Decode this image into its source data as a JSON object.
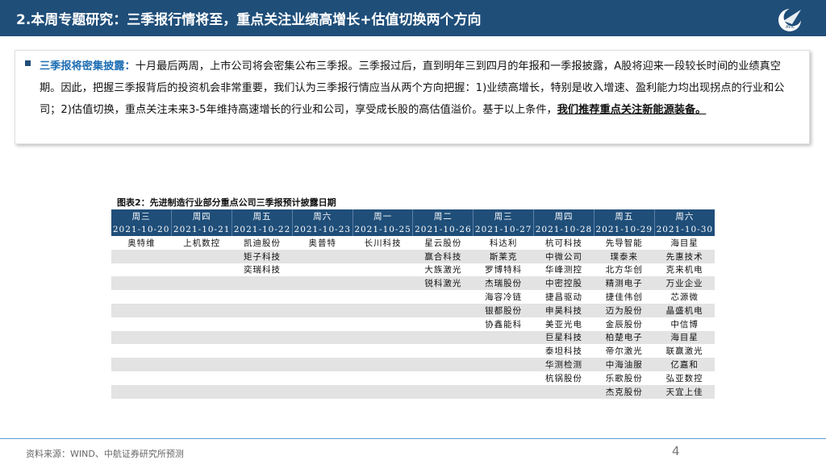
{
  "header": {
    "title": "2.本周专题研究：三季报行情将至，重点关注业绩高增长+估值切换两个方向",
    "logo_text": "AVIC"
  },
  "summary": {
    "lead": "三季报将密集披露：",
    "body": "十月最后两周，上市公司将会密集公布三季报。三季报过后，直到明年三到四月的年报和一季报披露，A股将迎来一段较长时间的业绩真空期。因此，把握三季报背后的投资机会非常重要，我们认为三季报行情应当从两个方向把握：1)业绩高增长，特别是收入增速、盈利能力均出现拐点的行业和公司；2)估值切换，重点关注未来3-5年维持高速增长的行业和公司，享受成长股的高估值溢价。基于以上条件，",
    "conclusion": "我们推荐重点关注新能源装备。"
  },
  "table": {
    "caption": "图表2：先进制造行业部分重点公司三季报预计披露日期",
    "columns": [
      {
        "day": "周三",
        "date": "2021-10-20",
        "companies": [
          "奥特维"
        ]
      },
      {
        "day": "周四",
        "date": "2021-10-21",
        "companies": [
          "上机数控"
        ]
      },
      {
        "day": "周五",
        "date": "2021-10-22",
        "companies": [
          "凯迪股份",
          "矩子科技",
          "奕瑞科技"
        ]
      },
      {
        "day": "周六",
        "date": "2021-10-23",
        "companies": [
          "奥普特"
        ]
      },
      {
        "day": "周一",
        "date": "2021-10-25",
        "companies": [
          "长川科技"
        ]
      },
      {
        "day": "周二",
        "date": "2021-10-26",
        "companies": [
          "星云股份",
          "赢合科技",
          "大族激光",
          "锐科激光"
        ]
      },
      {
        "day": "周三",
        "date": "2021-10-27",
        "companies": [
          "科达利",
          "斯莱克",
          "罗博特科",
          "杰瑞股份",
          "海容冷链",
          "银都股份",
          "协鑫能科"
        ]
      },
      {
        "day": "周四",
        "date": "2021-10-28",
        "companies": [
          "杭可科技",
          "中微公司",
          "华峰测控",
          "中密控股",
          "捷昌驱动",
          "申昊科技",
          "美亚光电",
          "巨星科技",
          "泰坦科技",
          "华测检测",
          "杭锅股份"
        ]
      },
      {
        "day": "周五",
        "date": "2021-10-29",
        "companies": [
          "先导智能",
          "璞泰来",
          "北方华创",
          "精测电子",
          "捷佳伟创",
          "迈为股份",
          "金辰股份",
          "柏楚电子",
          "帝尔激光",
          "中海油服",
          "乐歌股份",
          "杰克股份"
        ]
      },
      {
        "day": "周六",
        "date": "2021-10-30",
        "companies": [
          "海目星",
          "先惠技术",
          "克来机电",
          "万业企业",
          "芯源微",
          "晶盛机电",
          "中信博",
          "海目星",
          "联赢激光",
          "亿嘉和",
          "弘亚数控",
          "天宜上佳"
        ]
      }
    ]
  },
  "footer": {
    "source": "资料来源：WIND、中航证券研究所预测",
    "page": "4"
  }
}
